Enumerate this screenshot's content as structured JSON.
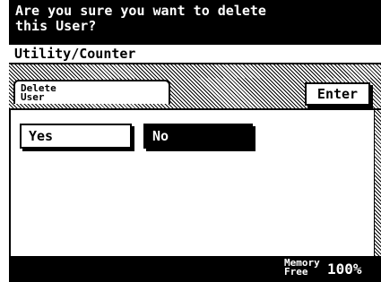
{
  "prompt": {
    "line1": "Are you sure you want to delete",
    "line2": "this User?"
  },
  "breadcrumb": "Utility/Counter",
  "tab": {
    "line1": "Delete",
    "line2": "User"
  },
  "buttons": {
    "enter": "Enter",
    "yes": "Yes",
    "no": "No",
    "selected": "No"
  },
  "footer": {
    "memory_line1": "Memory",
    "memory_line2": "Free",
    "memory_value": "100%"
  }
}
